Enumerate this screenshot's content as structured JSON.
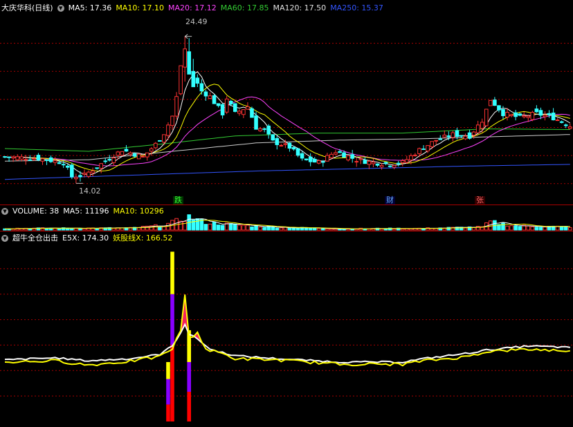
{
  "main": {
    "title": "大庆华科(日线)",
    "ma": [
      {
        "label": "MA5: 17.36",
        "color": "#ffffff"
      },
      {
        "label": "MA10: 17.10",
        "color": "#ffff00"
      },
      {
        "label": "MA20: 17.12",
        "color": "#ff44ff"
      },
      {
        "label": "MA60: 17.85",
        "color": "#33cc33"
      },
      {
        "label": "MA120: 17.50",
        "color": "#e0e0e0"
      },
      {
        "label": "MA250: 15.37",
        "color": "#3355ff"
      }
    ],
    "high_label": "24.49",
    "low_label": "14.02",
    "events": [
      {
        "text": "跌",
        "color": "#33ff33",
        "bg": "#003300"
      },
      {
        "text": "财",
        "color": "#66aaff",
        "bg": "#000033"
      },
      {
        "text": "张",
        "color": "#ff6666",
        "bg": "#330000"
      }
    ]
  },
  "volume": {
    "title": "VOLUME: 38",
    "ma5": "MA5: 11196",
    "ma10": "MA10: 10296"
  },
  "indicator": {
    "title": "超牛全仓出击",
    "e5x": "E5X: 174.30",
    "yao": "妖股线X: 166.52"
  },
  "colors": {
    "up": "#ff3333",
    "down": "#33ffff",
    "grid": "#aa0000",
    "e5x": "#ffffff",
    "yao": "#ffff00",
    "purple": "#8800ff"
  },
  "chart_data": [
    {
      "type": "candlestick",
      "name": "price",
      "last_ma": {
        "MA5": 17.36,
        "MA10": 17.1,
        "MA20": 17.12,
        "MA60": 17.85,
        "MA120": 17.5,
        "MA250": 15.37
      },
      "ylim": [
        13.2,
        26.0
      ],
      "high": 24.49,
      "low": 14.02,
      "grid": true,
      "events": [
        {
          "label": "跌",
          "index": 41
        },
        {
          "label": "财",
          "index": 93
        },
        {
          "label": "张",
          "index": 114
        }
      ]
    },
    {
      "type": "bar",
      "name": "volume",
      "current": 38,
      "ma5": 11196,
      "ma10": 10296,
      "ylim": [
        0,
        42000
      ]
    },
    {
      "type": "line",
      "name": "indicator",
      "e5x": 174.3,
      "yao": 166.52,
      "ylim": [
        0,
        420
      ]
    }
  ]
}
